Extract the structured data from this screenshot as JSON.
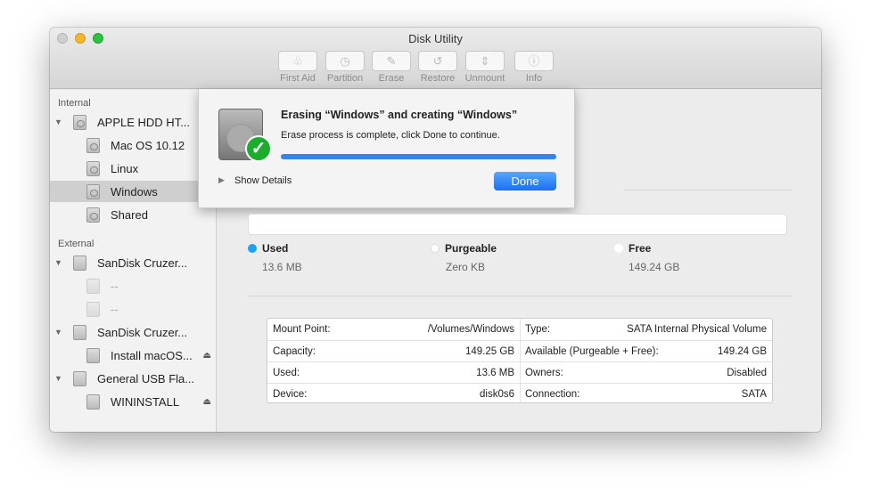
{
  "window": {
    "title": "Disk Utility"
  },
  "toolbar": [
    {
      "label": "First Aid",
      "icon": "stethoscope-icon",
      "glyph": "♧"
    },
    {
      "label": "Partition",
      "icon": "pie-icon",
      "glyph": "◷"
    },
    {
      "label": "Erase",
      "icon": "erase-icon",
      "glyph": "✎"
    },
    {
      "label": "Restore",
      "icon": "restore-icon",
      "glyph": "↺"
    },
    {
      "label": "Unmount",
      "icon": "unmount-icon",
      "glyph": "⇕"
    },
    {
      "label": "Info",
      "icon": "info-icon",
      "glyph": "ⓘ"
    }
  ],
  "sidebar": {
    "internal_label": "Internal",
    "external_label": "External",
    "items": [
      {
        "label": "APPLE HDD HT..."
      },
      {
        "label": "Mac OS 10.12"
      },
      {
        "label": "Linux"
      },
      {
        "label": "Windows"
      },
      {
        "label": "Shared"
      },
      {
        "label": "SanDisk Cruzer..."
      },
      {
        "label": "--"
      },
      {
        "label": "--"
      },
      {
        "label": "SanDisk Cruzer..."
      },
      {
        "label": "Install macOS..."
      },
      {
        "label": "General USB Fla..."
      },
      {
        "label": "WININSTALL"
      }
    ]
  },
  "sheet": {
    "title": "Erasing “Windows” and creating “Windows”",
    "message": "Erase process is complete, click Done to continue.",
    "progress": 100,
    "show_details": "Show Details",
    "done": "Done"
  },
  "usage": {
    "used_label": "Used",
    "used_value": "13.6 MB",
    "purgeable_label": "Purgeable",
    "purgeable_value": "Zero KB",
    "free_label": "Free",
    "free_value": "149.24 GB",
    "used_color": "#1aa3f5"
  },
  "info": {
    "left": [
      [
        "Mount Point:",
        "/Volumes/Windows"
      ],
      [
        "Capacity:",
        "149.25 GB"
      ],
      [
        "Used:",
        "13.6 MB"
      ],
      [
        "Device:",
        "disk0s6"
      ]
    ],
    "right": [
      [
        "Type:",
        "SATA Internal Physical Volume"
      ],
      [
        "Available (Purgeable + Free):",
        "149.24 GB"
      ],
      [
        "Owners:",
        "Disabled"
      ],
      [
        "Connection:",
        "SATA"
      ]
    ]
  }
}
